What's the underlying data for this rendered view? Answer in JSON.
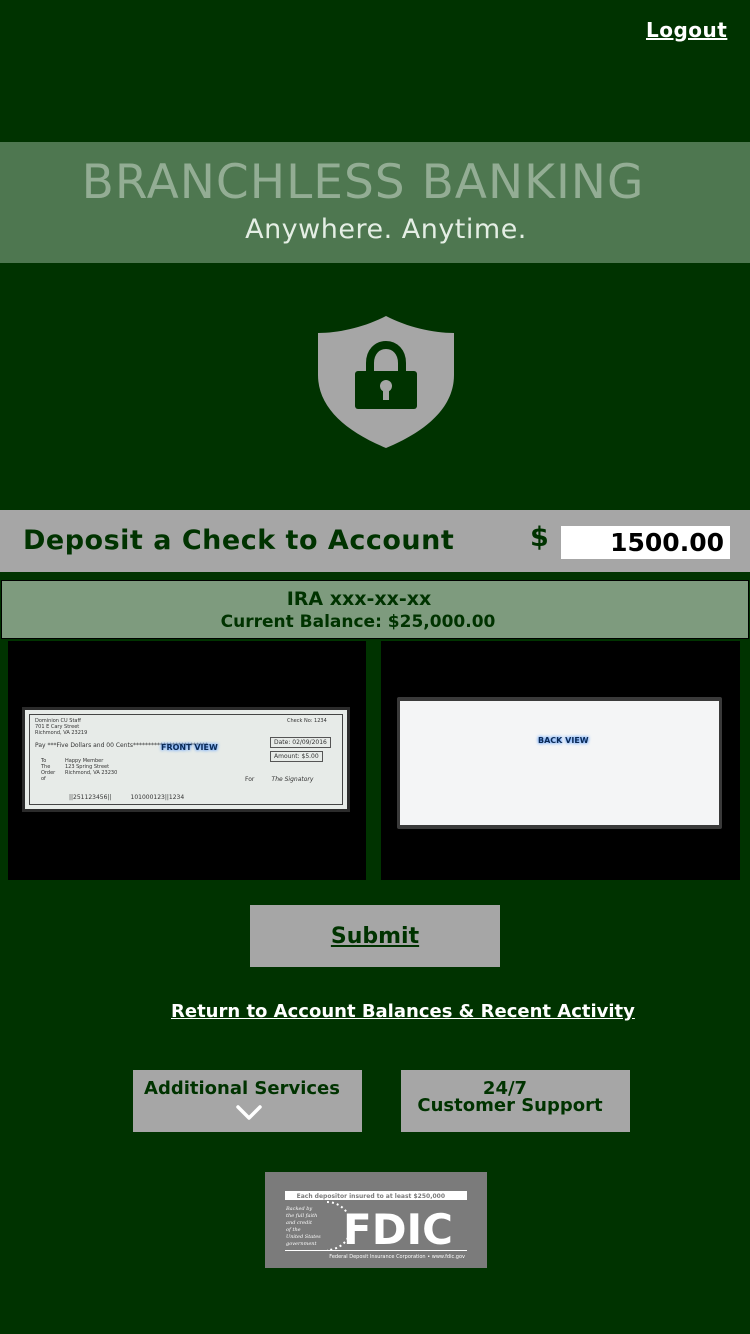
{
  "header": {
    "logout_label": "Logout"
  },
  "banner": {
    "title": "BRANCHLESS BANKING",
    "subtitle": "Anywhere.  Anytime."
  },
  "icons": {
    "shield": "shield-lock-icon",
    "chevron": "chevron-down-icon"
  },
  "deposit": {
    "title": "Deposit a Check to Account",
    "currency_symbol": "$",
    "amount": "1500.00"
  },
  "account": {
    "name": "IRA xxx-xx-xx",
    "balance": "Current Balance: $25,000.00"
  },
  "check_images": {
    "front_label": "FRONT VIEW",
    "back_label": "BACK VIEW"
  },
  "actions": {
    "submit_label": "Submit",
    "return_label": "Return to Account Balances & Recent Activity"
  },
  "bottom": {
    "services_label": "Additional Services",
    "support_line1": "24/7",
    "support_line2": "Customer Support"
  },
  "fdic": {
    "logo_text": "FDIC",
    "top_line": "Each depositor insured to at least $250,000",
    "side_text": "Backed by the full faith and credit of the United States government",
    "bottom_line": "Federal Deposit Insurance Corporation • www.fdic.gov"
  },
  "colors": {
    "background": "#003300",
    "banner": "#4e7750",
    "button_gray": "#a6a6a6",
    "account_box": "#7e9b7e",
    "text_dark_green": "#003300"
  }
}
